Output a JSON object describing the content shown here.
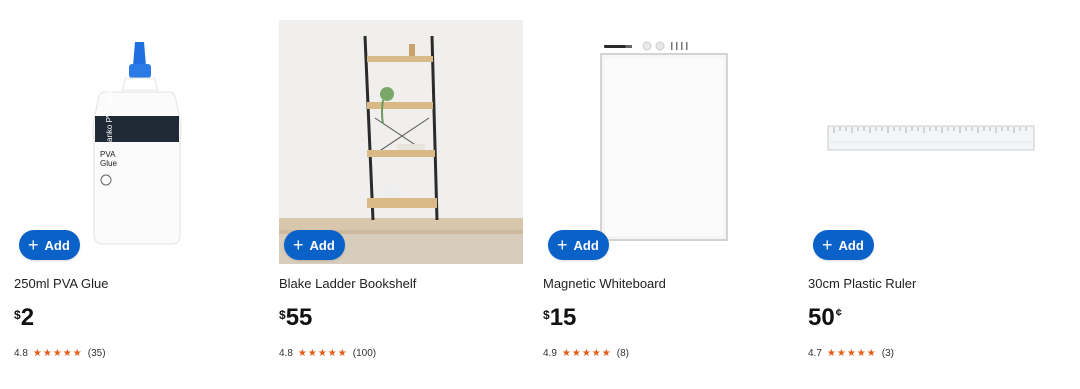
{
  "add_label": "Add",
  "products": [
    {
      "name": "250ml PVA Glue",
      "price_symbol": "$",
      "price": "2",
      "price_suffix": "",
      "rating": "4.8",
      "stars": "★★★★★",
      "reviews": "(35)",
      "image_label": "anko PVA Glue"
    },
    {
      "name": "Blake Ladder Bookshelf",
      "price_symbol": "$",
      "price": "55",
      "price_suffix": "",
      "rating": "4.8",
      "stars": "★★★★★",
      "reviews": "(100)"
    },
    {
      "name": "Magnetic Whiteboard",
      "price_symbol": "$",
      "price": "15",
      "price_suffix": "",
      "rating": "4.9",
      "stars": "★★★★★",
      "reviews": "(8)"
    },
    {
      "name": "30cm Plastic Ruler",
      "price_symbol": "",
      "price": "50",
      "price_suffix": "¢",
      "rating": "4.7",
      "stars": "★★★★★",
      "reviews": "(3)"
    }
  ],
  "colors": {
    "add_button": "#0a62c9",
    "star": "#e35d1a"
  }
}
